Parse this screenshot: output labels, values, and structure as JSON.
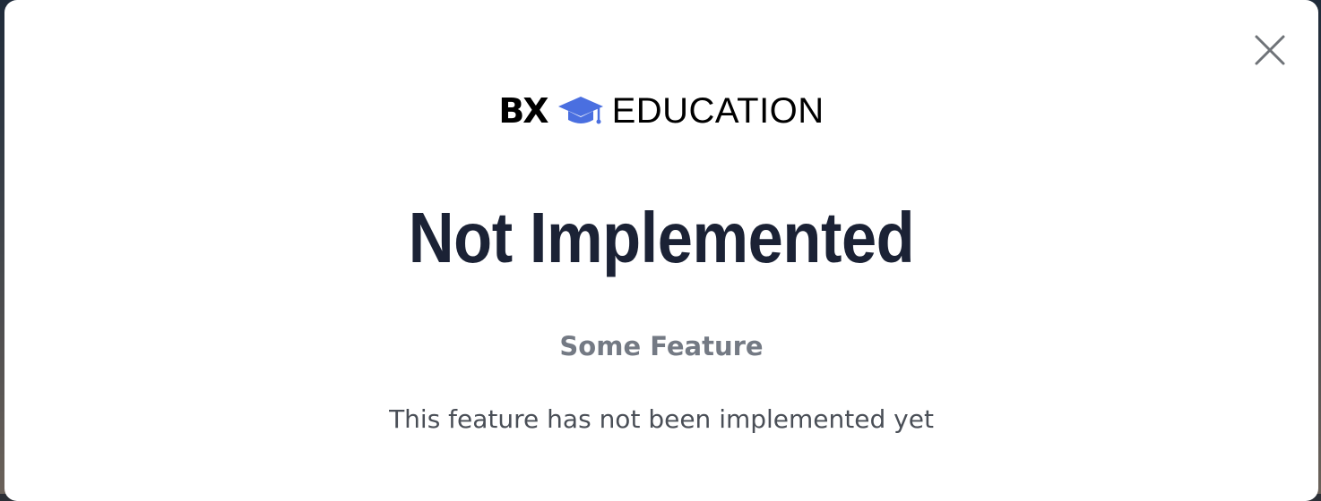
{
  "brand": {
    "mark": "BX",
    "name": "EDUCATION",
    "icon": "graduation-cap-icon",
    "icon_color": "#4a6fe0"
  },
  "modal": {
    "title": "Not Implemented",
    "subtitle": "Some Feature",
    "message": "This feature has not been implemented yet",
    "close_icon": "close-icon"
  },
  "colors": {
    "title": "#1b2235",
    "subtitle": "#747a84",
    "message": "#4a4f57"
  }
}
